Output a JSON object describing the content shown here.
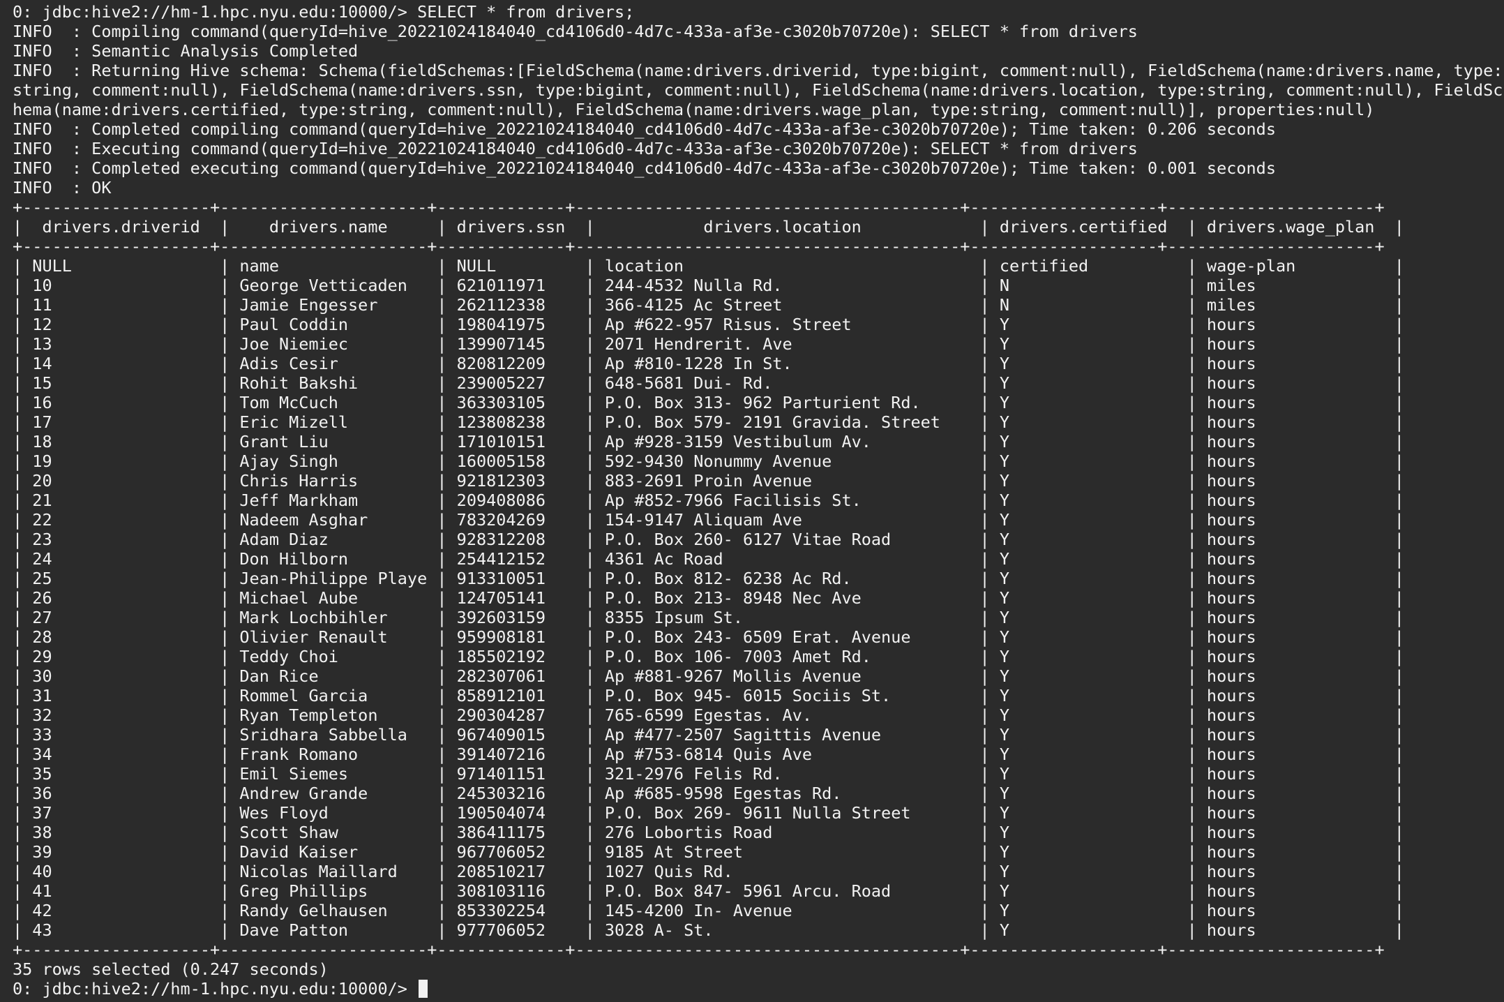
{
  "session": {
    "prompt": "0: jdbc:hive2://hm-1.hpc.nyu.edu:10000/>",
    "command": "SELECT * from drivers;"
  },
  "log": [
    "INFO  : Compiling command(queryId=hive_20221024184040_cd4106d0-4d7c-433a-af3e-c3020b70720e): SELECT * from drivers",
    "INFO  : Semantic Analysis Completed",
    "INFO  : Returning Hive schema: Schema(fieldSchemas:[FieldSchema(name:drivers.driverid, type:bigint, comment:null), FieldSchema(name:drivers.name, type:",
    "string, comment:null), FieldSchema(name:drivers.ssn, type:bigint, comment:null), FieldSchema(name:drivers.location, type:string, comment:null), FieldSc",
    "hema(name:drivers.certified, type:string, comment:null), FieldSchema(name:drivers.wage_plan, type:string, comment:null)], properties:null)",
    "INFO  : Completed compiling command(queryId=hive_20221024184040_cd4106d0-4d7c-433a-af3e-c3020b70720e); Time taken: 0.206 seconds",
    "INFO  : Executing command(queryId=hive_20221024184040_cd4106d0-4d7c-433a-af3e-c3020b70720e): SELECT * from drivers",
    "INFO  : Completed executing command(queryId=hive_20221024184040_cd4106d0-4d7c-433a-af3e-c3020b70720e); Time taken: 0.001 seconds",
    "INFO  : OK"
  ],
  "table": {
    "border": "+-------------------+---------------------+-------------+---------------------------------------+-------------------+---------------------+",
    "header": "|  drivers.driverid  |    drivers.name     | drivers.ssn  |           drivers.location            | drivers.certified  | drivers.wage_plan  |",
    "rows": [
      "| NULL               | name                | NULL         | location                              | certified          | wage-plan          |",
      "| 10                 | George Vetticaden   | 621011971    | 244-4532 Nulla Rd.                    | N                  | miles              |",
      "| 11                 | Jamie Engesser      | 262112338    | 366-4125 Ac Street                    | N                  | miles              |",
      "| 12                 | Paul Coddin         | 198041975    | Ap #622-957 Risus. Street             | Y                  | hours              |",
      "| 13                 | Joe Niemiec         | 139907145    | 2071 Hendrerit. Ave                   | Y                  | hours              |",
      "| 14                 | Adis Cesir          | 820812209    | Ap #810-1228 In St.                   | Y                  | hours              |",
      "| 15                 | Rohit Bakshi        | 239005227    | 648-5681 Dui- Rd.                     | Y                  | hours              |",
      "| 16                 | Tom McCuch          | 363303105    | P.O. Box 313- 962 Parturient Rd.      | Y                  | hours              |",
      "| 17                 | Eric Mizell         | 123808238    | P.O. Box 579- 2191 Gravida. Street    | Y                  | hours              |",
      "| 18                 | Grant Liu           | 171010151    | Ap #928-3159 Vestibulum Av.           | Y                  | hours              |",
      "| 19                 | Ajay Singh          | 160005158    | 592-9430 Nonummy Avenue               | Y                  | hours              |",
      "| 20                 | Chris Harris        | 921812303    | 883-2691 Proin Avenue                 | Y                  | hours              |",
      "| 21                 | Jeff Markham        | 209408086    | Ap #852-7966 Facilisis St.            | Y                  | hours              |",
      "| 22                 | Nadeem Asghar       | 783204269    | 154-9147 Aliquam Ave                  | Y                  | hours              |",
      "| 23                 | Adam Diaz           | 928312208    | P.O. Box 260- 6127 Vitae Road         | Y                  | hours              |",
      "| 24                 | Don Hilborn         | 254412152    | 4361 Ac Road                          | Y                  | hours              |",
      "| 25                 | Jean-Philippe Playe | 913310051    | P.O. Box 812- 6238 Ac Rd.             | Y                  | hours              |",
      "| 26                 | Michael Aube        | 124705141    | P.O. Box 213- 8948 Nec Ave            | Y                  | hours              |",
      "| 27                 | Mark Lochbihler     | 392603159    | 8355 Ipsum St.                        | Y                  | hours              |",
      "| 28                 | Olivier Renault     | 959908181    | P.O. Box 243- 6509 Erat. Avenue       | Y                  | hours              |",
      "| 29                 | Teddy Choi          | 185502192    | P.O. Box 106- 7003 Amet Rd.           | Y                  | hours              |",
      "| 30                 | Dan Rice            | 282307061    | Ap #881-9267 Mollis Avenue            | Y                  | hours              |",
      "| 31                 | Rommel Garcia       | 858912101    | P.O. Box 945- 6015 Sociis St.         | Y                  | hours              |",
      "| 32                 | Ryan Templeton      | 290304287    | 765-6599 Egestas. Av.                 | Y                  | hours              |",
      "| 33                 | Sridhara Sabbella   | 967409015    | Ap #477-2507 Sagittis Avenue          | Y                  | hours              |",
      "| 34                 | Frank Romano        | 391407216    | Ap #753-6814 Quis Ave                 | Y                  | hours              |",
      "| 35                 | Emil Siemes         | 971401151    | 321-2976 Felis Rd.                    | Y                  | hours              |",
      "| 36                 | Andrew Grande       | 245303216    | Ap #685-9598 Egestas Rd.              | Y                  | hours              |",
      "| 37                 | Wes Floyd           | 190504074    | P.O. Box 269- 9611 Nulla Street       | Y                  | hours              |",
      "| 38                 | Scott Shaw          | 386411175    | 276 Lobortis Road                     | Y                  | hours              |",
      "| 39                 | David Kaiser        | 967706052    | 9185 At Street                        | Y                  | hours              |",
      "| 40                 | Nicolas Maillard    | 208510217    | 1027 Quis Rd.                         | Y                  | hours              |",
      "| 41                 | Greg Phillips       | 308103116    | P.O. Box 847- 5961 Arcu. Road         | Y                  | hours              |",
      "| 42                 | Randy Gelhausen     | 853302254    | 145-4200 In- Avenue                   | Y                  | hours              |",
      "| 43                 | Dave Patton         | 977706052    | 3028 A- St.                           | Y                  | hours              |"
    ]
  },
  "summary": "35 rows selected (0.247 seconds)",
  "final_prompt": "0: jdbc:hive2://hm-1.hpc.nyu.edu:10000/> "
}
